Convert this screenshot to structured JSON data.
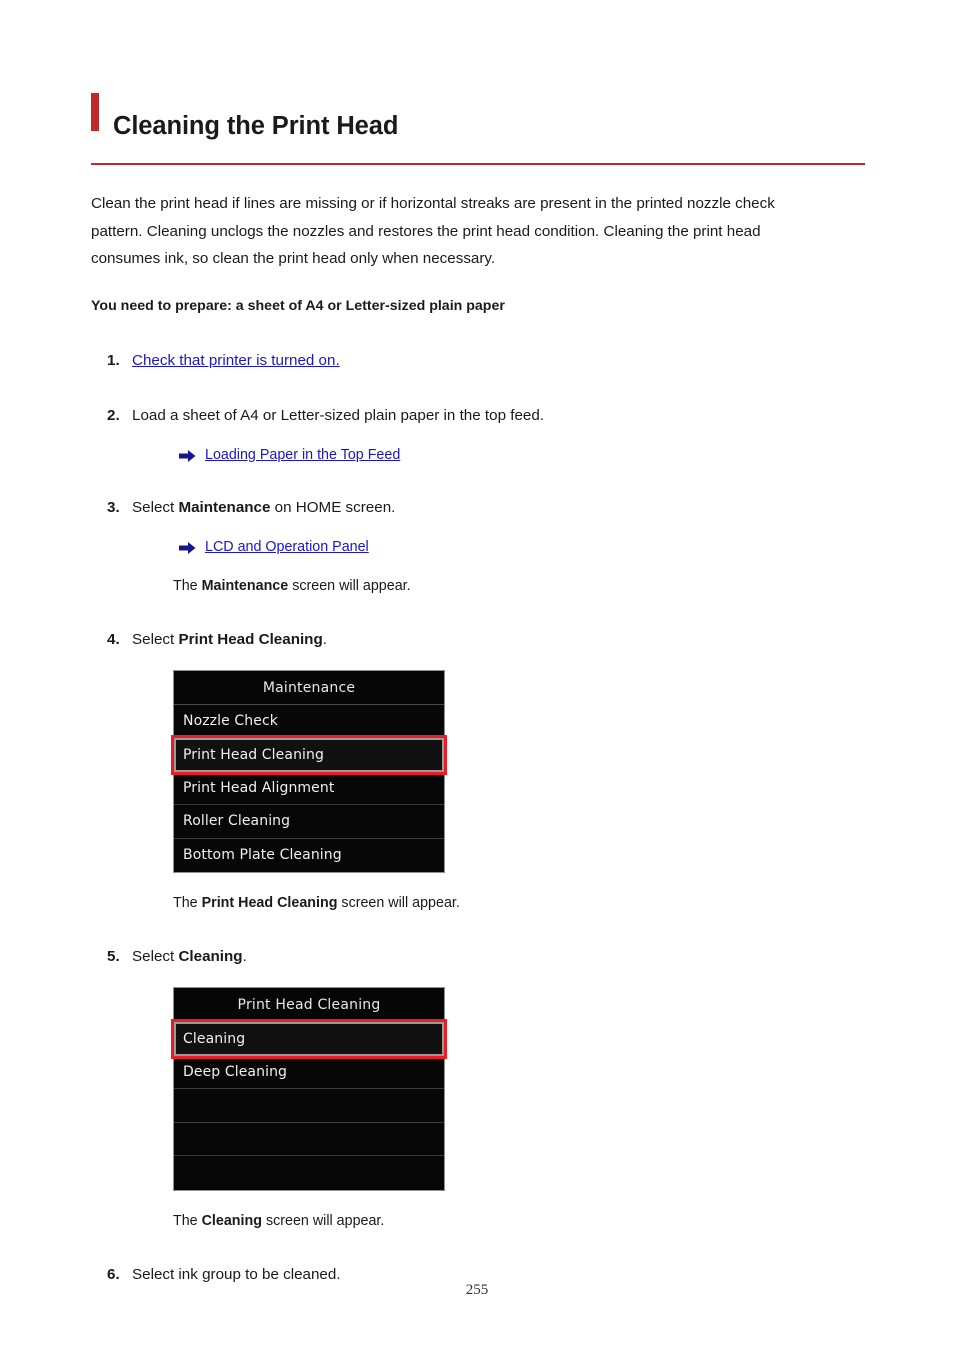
{
  "document": {
    "title": "Cleaning the Print Head",
    "page_number": "255",
    "accent_color": "#C1272D",
    "link_color": "#1B15CC"
  },
  "intro_paragraph": "Clean the print head if lines are missing or if horizontal streaks are present in the printed nozzle check pattern. Cleaning unclogs the nozzles and restores the print head condition. Cleaning the print head consumes ink, so clean the print head only when necessary.",
  "prepare_note": "You need to prepare: a sheet of A4 or Letter-sized plain paper",
  "steps": [
    {
      "number": "1.",
      "link_text": "Check that printer is turned on."
    },
    {
      "number": "2.",
      "text": "Load a sheet of A4 or Letter-sized plain paper in the top feed.",
      "sublink": "Loading Paper in the Top Feed"
    },
    {
      "number": "3.",
      "text_before": "Select ",
      "text_bold": "Maintenance",
      "text_after": " on HOME screen.",
      "sublink": "LCD and Operation Panel",
      "note_before": "The ",
      "note_bold": "Maintenance",
      "note_after": " screen will appear."
    },
    {
      "number": "4.",
      "text_before": "Select ",
      "text_bold": "Print Head Cleaning",
      "text_after": ".",
      "note_before": "The ",
      "note_bold": "Print Head Cleaning",
      "note_after": " screen will appear."
    },
    {
      "number": "5.",
      "text_before": "Select ",
      "text_bold": "Cleaning",
      "text_after": ".",
      "note_before": "The ",
      "note_bold": "Cleaning",
      "note_after": " screen will appear."
    },
    {
      "number": "6.",
      "text": "Select ink group to be cleaned."
    }
  ],
  "lcd_screens": [
    {
      "id": "maintenance-screen",
      "title": "Maintenance",
      "rows": [
        {
          "label": "Nozzle Check",
          "selected": false
        },
        {
          "label": "Print Head Cleaning",
          "selected": true
        },
        {
          "label": "Print Head Alignment",
          "selected": false
        },
        {
          "label": "Roller Cleaning",
          "selected": false
        },
        {
          "label": "Bottom Plate Cleaning",
          "selected": false
        }
      ]
    },
    {
      "id": "print-head-cleaning-screen",
      "title": "Print Head Cleaning",
      "rows": [
        {
          "label": "Cleaning",
          "selected": true
        },
        {
          "label": "Deep Cleaning",
          "selected": false
        },
        {
          "label": "",
          "selected": false
        },
        {
          "label": "",
          "selected": false
        },
        {
          "label": "",
          "selected": false
        }
      ]
    }
  ],
  "icons": {
    "arrow_bullet": "right-arrow-icon"
  }
}
